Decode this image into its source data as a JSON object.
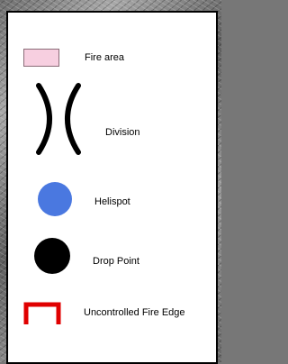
{
  "legend": {
    "items": [
      {
        "label": "Fire area",
        "icon": "fire-area-icon",
        "color": "#f7cfe0"
      },
      {
        "label": "Division",
        "icon": "division-icon",
        "color": "#000000"
      },
      {
        "label": "Helispot",
        "icon": "helispot-icon",
        "color": "#4a78e0"
      },
      {
        "label": "Drop Point",
        "icon": "drop-point-icon",
        "color": "#000000"
      },
      {
        "label": "Uncontrolled Fire Edge",
        "icon": "uncontrolled-fire-edge-icon",
        "color": "#e00000"
      }
    ]
  }
}
